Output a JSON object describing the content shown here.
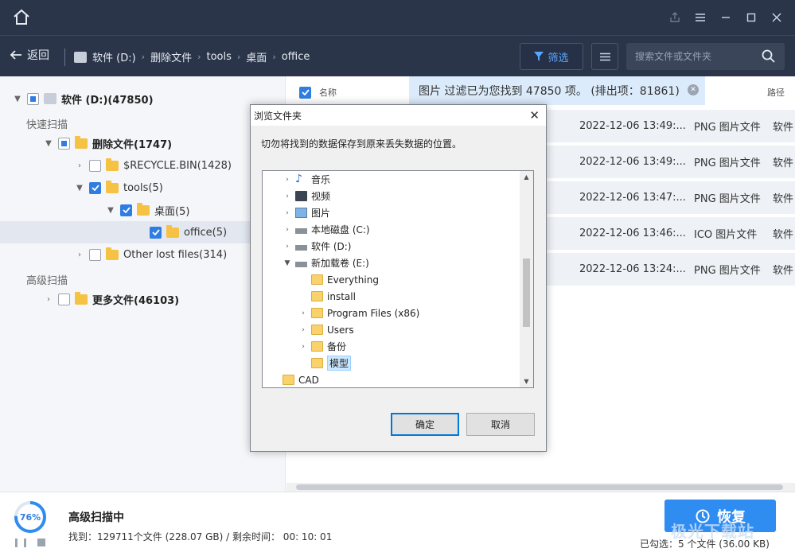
{
  "titlebar": {
    "home_icon": "home-icon"
  },
  "nav": {
    "back_label": "返回",
    "crumbs": [
      "软件 (D:)",
      "删除文件",
      "tools",
      "桌面",
      "office"
    ],
    "filter_label": "筛选",
    "search_placeholder": "搜索文件或文件夹"
  },
  "tree": {
    "root": "软件 (D:)(47850)",
    "quick_scan": "快速扫描",
    "deleted": "删除文件(1747)",
    "recycle": "$RECYCLE.BIN(1428)",
    "tools": "tools(5)",
    "desktop": "桌面(5)",
    "office": "office(5)",
    "other": "Other lost files(314)",
    "advanced_scan": "高级扫描",
    "more": "更多文件(46103)"
  },
  "list": {
    "col_name": "名称",
    "col_path": "路径",
    "rows": [
      {
        "date": "2022-12-06 13:49:...",
        "type": "PNG 图片文件",
        "path": "软件"
      },
      {
        "date": "2022-12-06 13:49:...",
        "type": "PNG 图片文件",
        "path": "软件"
      },
      {
        "date": "2022-12-06 13:47:...",
        "type": "PNG 图片文件",
        "path": "软件"
      },
      {
        "date": "2022-12-06 13:46:...",
        "type": "ICO 图片文件",
        "path": "软件"
      },
      {
        "date": "2022-12-06 13:24:...",
        "type": "PNG 图片文件",
        "path": "软件"
      }
    ]
  },
  "banner": "图片 过滤已为您找到 47850 项。 (排出项：81861)",
  "dialog": {
    "title": "浏览文件夹",
    "message": "切勿将找到的数据保存到原来丢失数据的位置。",
    "items": [
      "音乐",
      "视频",
      "图片",
      "本地磁盘 (C:)",
      "软件 (D:)",
      "新加载卷 (E:)",
      "Everything",
      "install",
      "Program Files (x86)",
      "Users",
      "备份",
      "模型",
      "CAD"
    ],
    "ok_label": "确定",
    "cancel_label": "取消"
  },
  "status": {
    "progress_label": "76%",
    "progress": 0.76,
    "title": "高级扫描中",
    "found": "找到：129711个文件 (228.07 GB) / 剩余时间：  00: 10: 01",
    "recover_label": "恢复",
    "selected": "已勾选：5 个文件 (36.00 KB)",
    "watermark": "极光下载站"
  },
  "colors": {
    "accent": "#2f8cf1",
    "titlebar": "#2b3549",
    "folder": "#f6c243"
  }
}
